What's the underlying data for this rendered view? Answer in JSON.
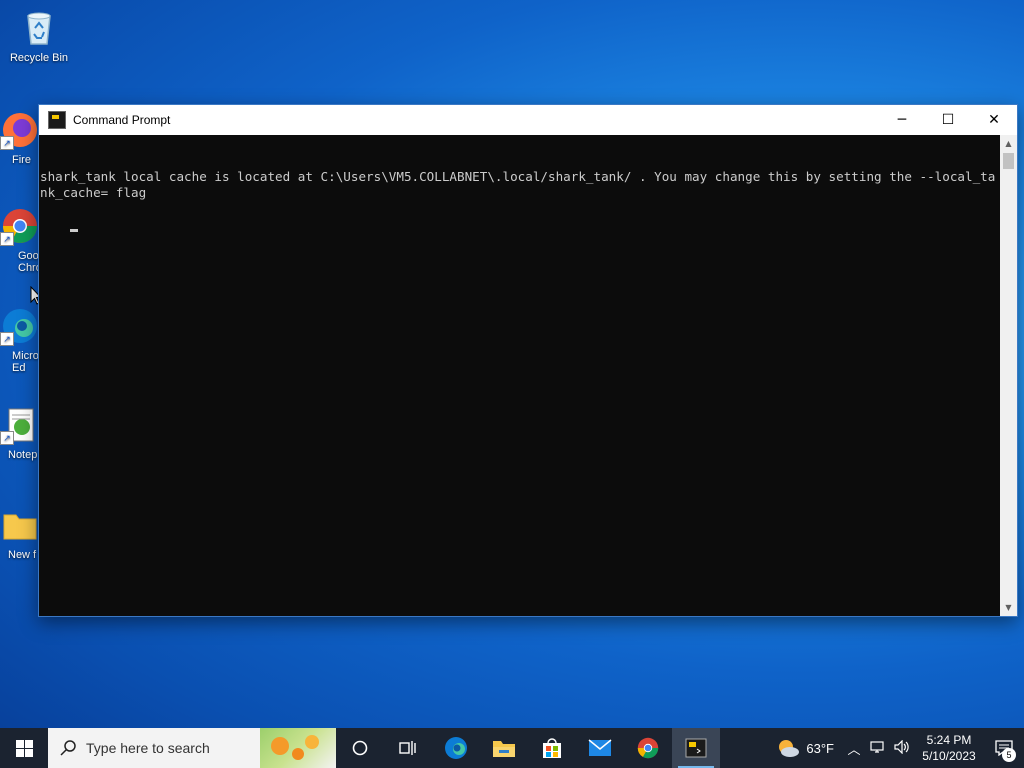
{
  "desktop": {
    "icons": [
      {
        "label": "Recycle Bin",
        "icon": "recycle-bin-icon"
      },
      {
        "label": "Fire",
        "icon": "firefox-icon"
      },
      {
        "label": "Goo\nChro",
        "icon": "chrome-icon"
      },
      {
        "label": "Micro\nEd",
        "icon": "edge-icon"
      },
      {
        "label": "Notep",
        "icon": "notepad-icon"
      },
      {
        "label": "New f",
        "icon": "folder-icon"
      }
    ]
  },
  "window": {
    "title": "Command Prompt",
    "controls": {
      "minimize": "─",
      "maximize": "☐",
      "close": "✕"
    },
    "console_text": "shark_tank local cache is located at C:\\Users\\VM5.COLLABNET\\.local/shark_tank/ . You may change this by setting the --local_tank_cache= flag"
  },
  "taskbar": {
    "search_placeholder": "Type here to search",
    "apps": [
      "cortana-icon",
      "task-view-icon",
      "edge-icon",
      "file-explorer-icon",
      "microsoft-store-icon",
      "mail-icon",
      "chrome-icon",
      "command-prompt-icon"
    ],
    "weather": {
      "temp": "63°F",
      "icon": "partly-sunny-icon"
    },
    "clock": {
      "time": "5:24 PM",
      "date": "5/10/2023"
    },
    "notifications": {
      "count": "5"
    }
  },
  "colors": {
    "desktop": "#1e8ae6",
    "taskbar": "#1b2330",
    "console_bg": "#0c0c0c",
    "console_fg": "#cccccc"
  }
}
